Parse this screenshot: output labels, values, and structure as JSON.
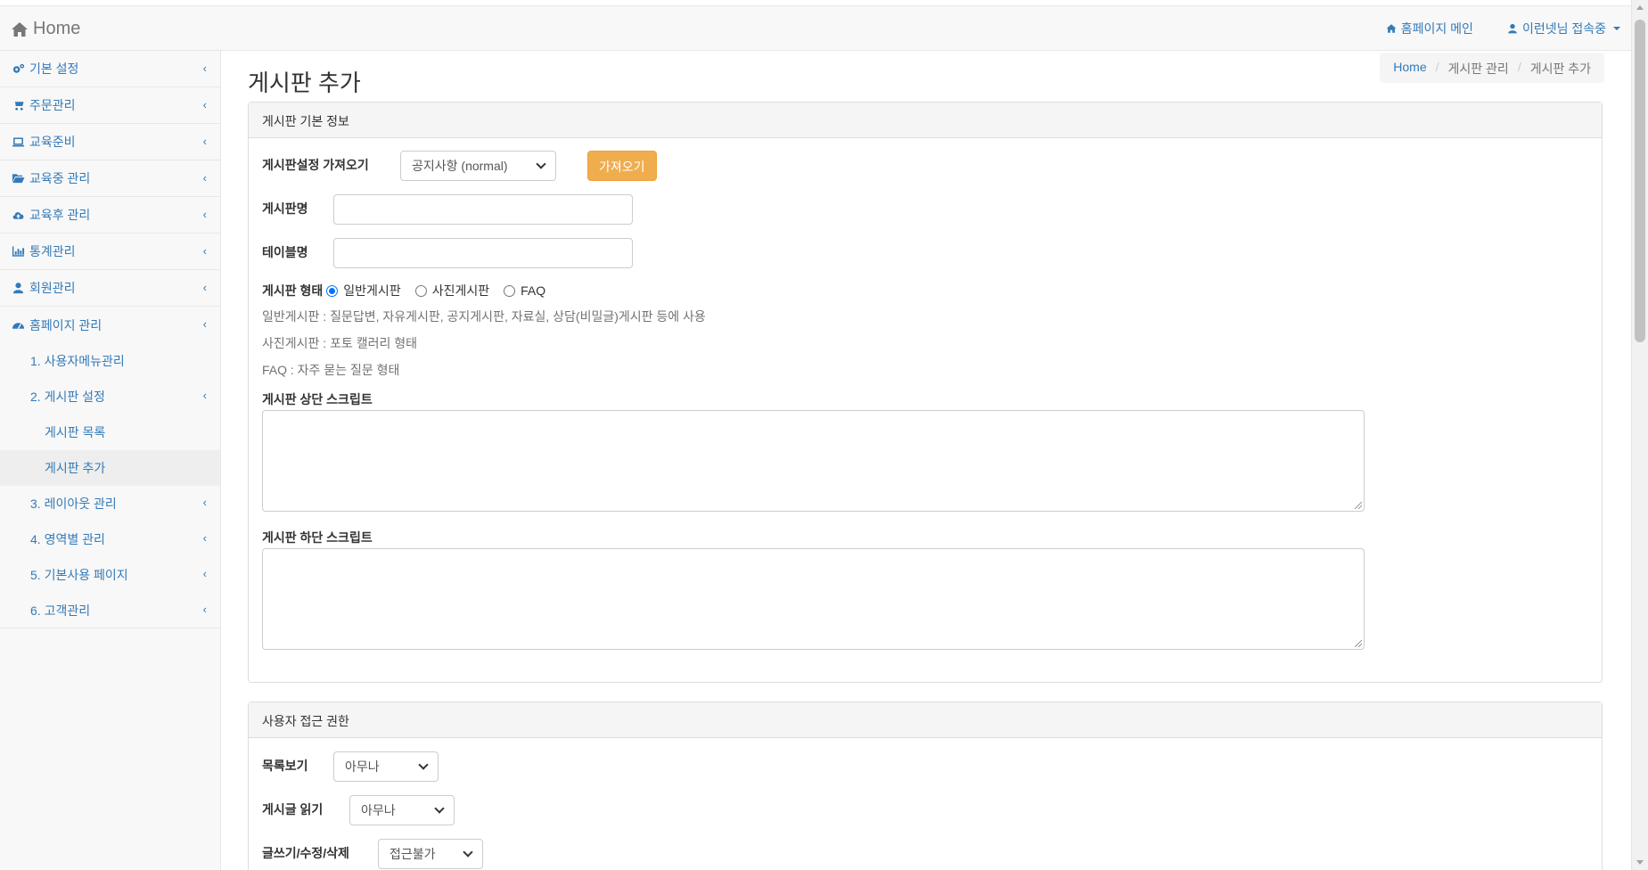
{
  "topbar": {
    "brand": "Home",
    "homepage_main": "홈페이지 메인",
    "user_status": "이런넷님 접속중"
  },
  "sidebar": {
    "items": [
      {
        "label": "기본 설정",
        "icon": "gears-icon"
      },
      {
        "label": "주문관리",
        "icon": "cart-icon"
      },
      {
        "label": "교육준비",
        "icon": "laptop-icon"
      },
      {
        "label": "교육중 관리",
        "icon": "folder-open-icon"
      },
      {
        "label": "교육후 관리",
        "icon": "cloud-upload-icon"
      },
      {
        "label": "통계관리",
        "icon": "bar-chart-icon"
      },
      {
        "label": "회원관리",
        "icon": "user-icon"
      },
      {
        "label": "홈페이지 관리",
        "icon": "dashboard-icon"
      }
    ],
    "sub": {
      "s1": "1. 사용자메뉴관리",
      "s2": "2. 게시판 설정",
      "s2a": "게시판 목록",
      "s2b": "게시판 추가",
      "s3": "3. 레이아웃 관리",
      "s4": "4. 영역별 관리",
      "s5": "5. 기본사용 페이지",
      "s6": "6. 고객관리"
    }
  },
  "page": {
    "title": "게시판 추가",
    "breadcrumb": [
      "Home",
      "게시판 관리",
      "게시판 추가"
    ]
  },
  "panel1": {
    "heading": "게시판 기본 정보",
    "import_label": "게시판설정 가져오기",
    "import_select_value": "공지사항 (normal)",
    "import_button": "가져오기",
    "board_name_label": "게시판명",
    "board_name_value": "",
    "table_name_label": "테이블명",
    "table_name_value": "",
    "type_label": "게시판 형태",
    "type_options": [
      "일반게시판",
      "사진게시판",
      "FAQ"
    ],
    "type_selected": "일반게시판",
    "help1": "일반게시판 : 질문답변, 자유게시판, 공지게시판, 자료실, 상담(비밀글)게시판 등에 사용",
    "help2": "사진게시판 : 포토 캘러리 형태",
    "help3": "FAQ : 자주 묻는 질문 형태",
    "top_script_label": "게시판 상단 스크립트",
    "bottom_script_label": "게시판 하단 스크립트"
  },
  "panel2": {
    "heading": "사용자 접근 권한",
    "list_view_label": "목록보기",
    "list_view_value": "아무나",
    "read_label": "게시글 읽기",
    "read_value": "아무나",
    "write_label": "글쓰기/수정/삭제",
    "write_value": "접근불가"
  },
  "colors": {
    "link": "#337ab7",
    "warning": "#f0ad4e"
  }
}
